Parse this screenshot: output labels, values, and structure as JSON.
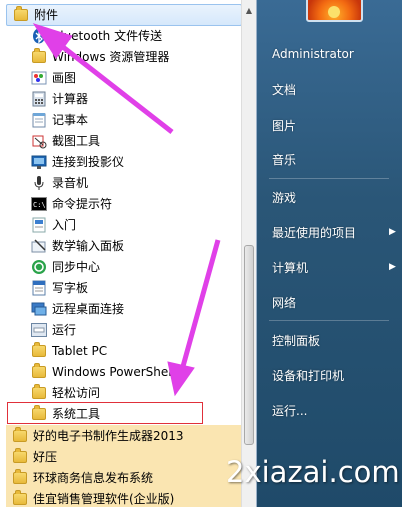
{
  "accessories_folder": "附件",
  "accessories_items": [
    {
      "label": "Bluetooth 文件传送",
      "icon": "bluetooth-icon"
    },
    {
      "label": "Windows 资源管理器",
      "icon": "explorer-icon"
    },
    {
      "label": "画图",
      "icon": "paint-icon"
    },
    {
      "label": "计算器",
      "icon": "calculator-icon"
    },
    {
      "label": "记事本",
      "icon": "notepad-icon"
    },
    {
      "label": "截图工具",
      "icon": "snipping-tool-icon"
    },
    {
      "label": "连接到投影仪",
      "icon": "projector-icon"
    },
    {
      "label": "录音机",
      "icon": "microphone-icon"
    },
    {
      "label": "命令提示符",
      "icon": "cmd-icon"
    },
    {
      "label": "入门",
      "icon": "getting-started-icon"
    },
    {
      "label": "数学输入面板",
      "icon": "math-input-icon"
    },
    {
      "label": "同步中心",
      "icon": "sync-center-icon"
    },
    {
      "label": "写字板",
      "icon": "wordpad-icon"
    },
    {
      "label": "远程桌面连接",
      "icon": "remote-desktop-icon"
    },
    {
      "label": "运行",
      "icon": "run-icon"
    },
    {
      "label": "Tablet PC",
      "icon": "folder-icon"
    },
    {
      "label": "Windows PowerShell",
      "icon": "folder-icon"
    },
    {
      "label": "轻松访问",
      "icon": "folder-icon"
    },
    {
      "label": "系统工具",
      "icon": "folder-icon"
    }
  ],
  "program_folders": [
    {
      "label": "好的电子书制作生成器2013"
    },
    {
      "label": "好压"
    },
    {
      "label": "环球商务信息发布系统"
    },
    {
      "label": "佳宜销售管理软件(企业版)"
    }
  ],
  "right_pane": {
    "user": "Administrator",
    "items": [
      {
        "label": "文档",
        "has_arrow": false
      },
      {
        "label": "图片",
        "has_arrow": false
      },
      {
        "label": "音乐",
        "has_arrow": false
      },
      {
        "label": "游戏",
        "has_arrow": false
      },
      {
        "label": "最近使用的项目",
        "has_arrow": true
      },
      {
        "label": "计算机",
        "has_arrow": true
      },
      {
        "label": "网络",
        "has_arrow": false
      },
      {
        "label": "控制面板",
        "has_arrow": false
      },
      {
        "label": "设备和打印机",
        "has_arrow": false
      },
      {
        "label": "运行...",
        "has_arrow": false
      }
    ]
  },
  "watermark": "2xiazai.com",
  "colors": {
    "annotation_arrow": "#e040e8",
    "selection_box": "#e0303a",
    "highlight": "#fae5b1"
  }
}
